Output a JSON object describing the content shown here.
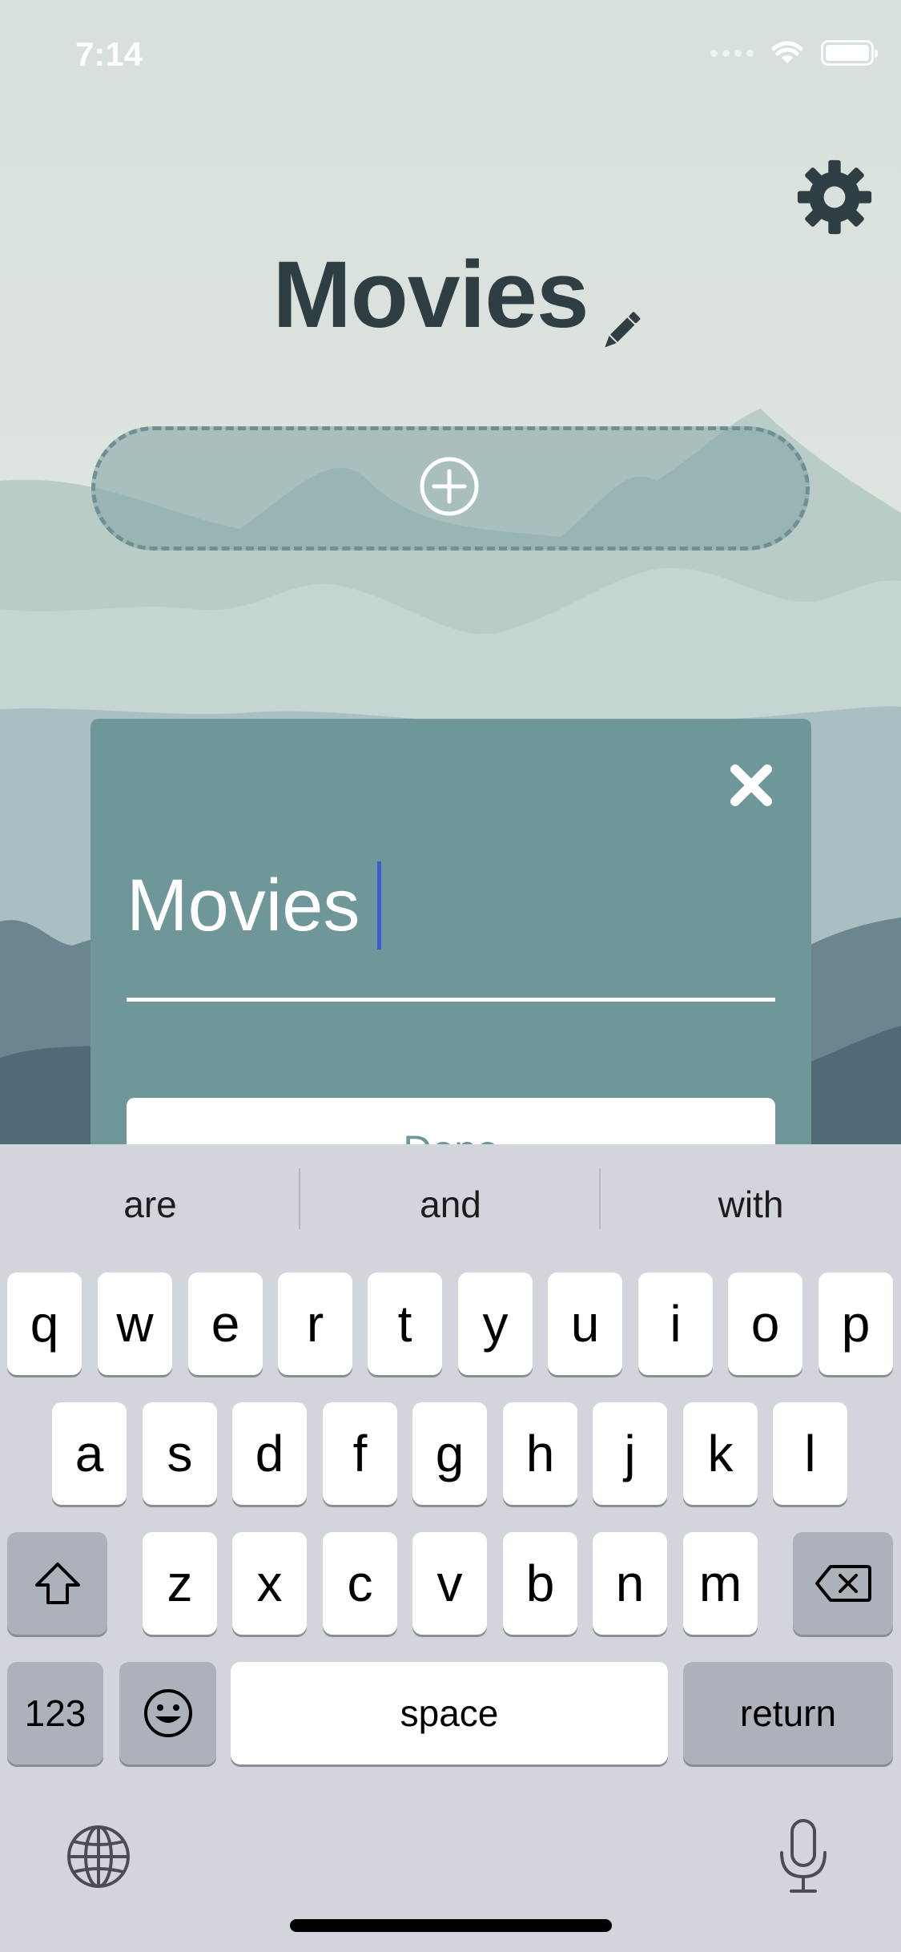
{
  "status_bar": {
    "time": "7:14"
  },
  "header": {
    "title": "Movies"
  },
  "modal": {
    "input_value": "Movies",
    "done_label": "Done"
  },
  "keyboard": {
    "suggestions": [
      "are",
      "and",
      "with"
    ],
    "row1": [
      "q",
      "w",
      "e",
      "r",
      "t",
      "y",
      "u",
      "i",
      "o",
      "p"
    ],
    "row2": [
      "a",
      "s",
      "d",
      "f",
      "g",
      "h",
      "j",
      "k",
      "l"
    ],
    "row3": [
      "z",
      "x",
      "c",
      "v",
      "b",
      "n",
      "m"
    ],
    "numbers_label": "123",
    "space_label": "space",
    "return_label": "return"
  },
  "icons": {
    "settings": "gear-icon",
    "edit": "pencil-icon",
    "add": "plus-circle-icon",
    "close": "close-icon",
    "shift": "shift-icon",
    "delete": "backspace-icon",
    "emoji": "emoji-icon",
    "globe": "globe-icon",
    "dictation": "microphone-icon"
  },
  "colors": {
    "title": "#2f3e42",
    "card": "#6f9799",
    "caret": "#3d5bd8",
    "keyboard_bg": "#d2d5db"
  }
}
